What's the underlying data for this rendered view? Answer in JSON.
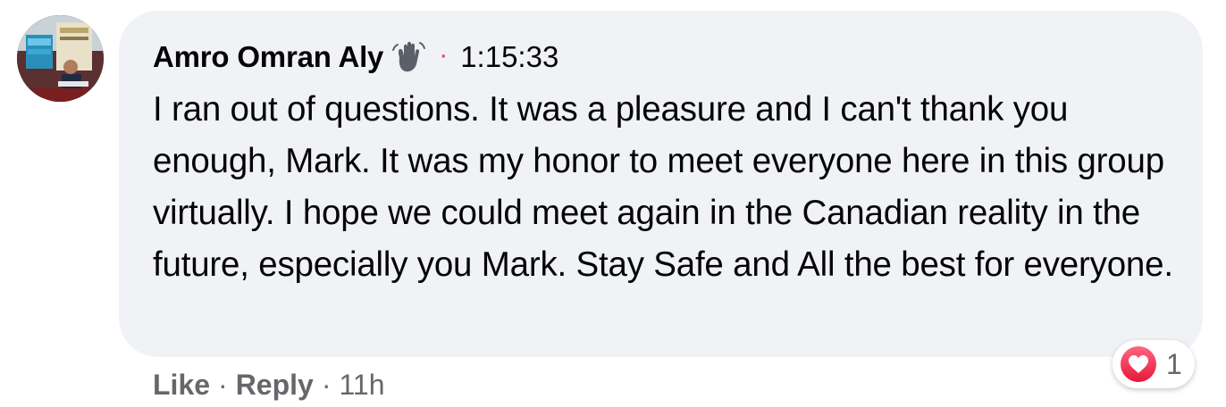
{
  "comment": {
    "author": "Amro Omran Aly",
    "author_badge_icon": "waving-hand-icon",
    "separator": "·",
    "timestamp": "1:15:33",
    "text": "I ran out of questions. It was a pleasure and I can't thank you enough, Mark. It was my honor to meet everyone here in this group virtually. I hope we could meet again in the Canadian reality in the future, especially you Mark. Stay Safe and All the best for everyone."
  },
  "actions": {
    "like_label": "Like",
    "separator": "·",
    "reply_label": "Reply",
    "age": "11h"
  },
  "reactions": {
    "icon": "heart-icon",
    "count": "1"
  },
  "colors": {
    "bubble_bg": "#f0f2f5",
    "secondary_text": "#65676b",
    "primary_text": "#050505",
    "timestamp_dot": "#e4414b",
    "heart": "#f33e58"
  }
}
